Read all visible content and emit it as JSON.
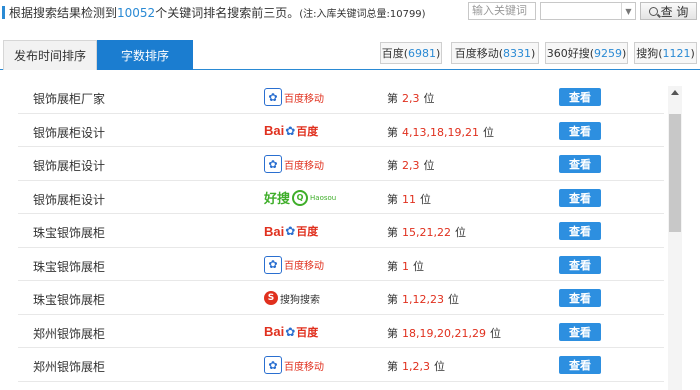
{
  "header": {
    "summary_prefix": "根据搜索结果检测到",
    "keyword_count": "10052",
    "summary_suffix": "个关键词排名搜索前三页。",
    "summary_note": "(注:入库关键词总量:10799)",
    "search_placeholder": "输入关键词",
    "query_label": "查 询"
  },
  "tabs": {
    "time_sort": "发布时间排序",
    "count_sort": "字数排序",
    "active": "count_sort"
  },
  "engine_tabs": [
    {
      "name": "百度",
      "count": "6981"
    },
    {
      "name": "百度移动",
      "count": "8331"
    },
    {
      "name": "360好搜",
      "count": "9259"
    },
    {
      "name": "搜狗",
      "count": "1121"
    }
  ],
  "logos": {
    "baidu_mobile_text": "百度移动",
    "baidu_bai": "Bai",
    "baidu_du": "百度",
    "haosou_hao": "好搜",
    "haosou_sub": "Haosou",
    "sogou_text": "搜狗搜索"
  },
  "rank_prefix": "第",
  "rank_suffix": "位",
  "view_label": "查看",
  "rows": [
    {
      "keyword": "银饰展柜厂家",
      "engine": "baidu-mobile",
      "positions": "2,3"
    },
    {
      "keyword": "银饰展柜设计",
      "engine": "baidu",
      "positions": "4,13,18,19,21"
    },
    {
      "keyword": "银饰展柜设计",
      "engine": "baidu-mobile",
      "positions": "2,3"
    },
    {
      "keyword": "银饰展柜设计",
      "engine": "haosou",
      "positions": "11"
    },
    {
      "keyword": "珠宝银饰展柜",
      "engine": "baidu",
      "positions": "15,21,22"
    },
    {
      "keyword": "珠宝银饰展柜",
      "engine": "baidu-mobile",
      "positions": "1"
    },
    {
      "keyword": "珠宝银饰展柜",
      "engine": "sogou",
      "positions": "1,12,23"
    },
    {
      "keyword": "郑州银饰展柜",
      "engine": "baidu",
      "positions": "18,19,20,21,29"
    },
    {
      "keyword": "郑州银饰展柜",
      "engine": "baidu-mobile",
      "positions": "1,2,3"
    }
  ],
  "colors": {
    "accent": "#1b7dd0",
    "rank_red": "#e0301e",
    "view_button": "#2d8fe0"
  }
}
